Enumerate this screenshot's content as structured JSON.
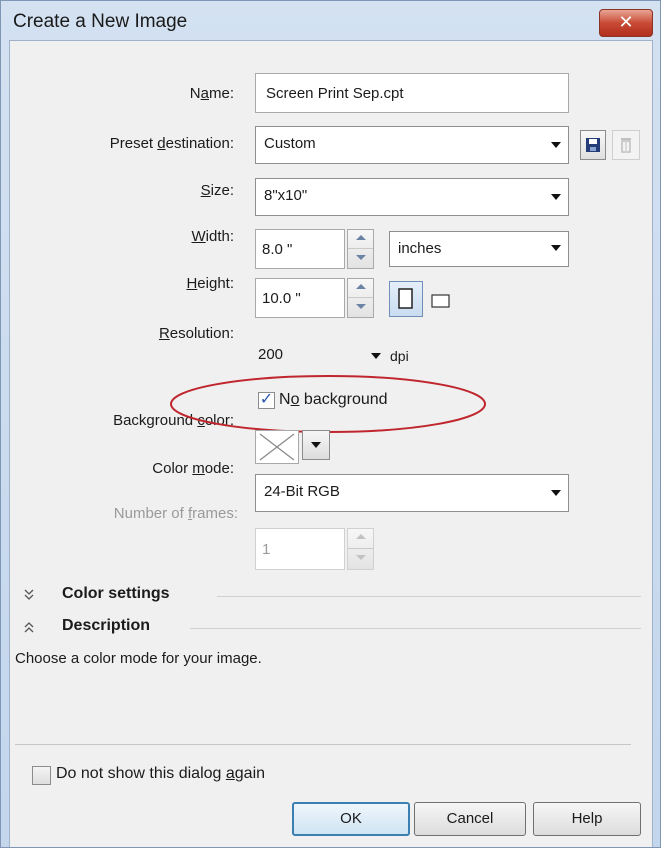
{
  "window": {
    "title": "Create a New Image",
    "close_glyph": "✕"
  },
  "labels": {
    "name": [
      "N",
      "a",
      "me:"
    ],
    "preset": [
      "Preset ",
      "d",
      "estination:"
    ],
    "size": [
      "",
      "S",
      "ize:"
    ],
    "width": [
      "",
      "W",
      "idth:"
    ],
    "height": [
      "",
      "H",
      "eight:"
    ],
    "resolution": [
      "",
      "R",
      "esolution:"
    ],
    "background": [
      "Background ",
      "c",
      "olor:"
    ],
    "color_mode": [
      "Color ",
      "m",
      "ode:"
    ],
    "frames": [
      "Number of ",
      "f",
      "rames:"
    ]
  },
  "fields": {
    "name": "Screen Print Sep.cpt",
    "preset": "Custom",
    "size": "8\"x10\"",
    "width": "8.0 \"",
    "units": "inches",
    "height": "10.0 \"",
    "resolution": "200",
    "resolution_unit": "dpi",
    "color_mode": "24-Bit RGB",
    "frames": "1"
  },
  "no_background": {
    "checked": true,
    "label": [
      "N",
      "o",
      " background"
    ]
  },
  "sections": {
    "color_settings": "Color settings",
    "description": "Description"
  },
  "description_text": "Choose a color mode for your image.",
  "dont_show": {
    "checked": false,
    "label": [
      "Do not show this dialog ",
      "a",
      "gain"
    ]
  },
  "buttons": {
    "ok": "OK",
    "cancel": "Cancel",
    "help": "Help"
  },
  "icons": [
    "close-icon",
    "save-preset-icon",
    "delete-preset-icon",
    "portrait-icon",
    "landscape-icon",
    "no-color-icon",
    "expand-icon",
    "collapse-icon",
    "checkmark-icon"
  ],
  "colors": {
    "title_bg": "#c8daee",
    "close_red": "#c84a35",
    "highlight_ellipse": "#c0262d",
    "check": "#2b56a8"
  }
}
